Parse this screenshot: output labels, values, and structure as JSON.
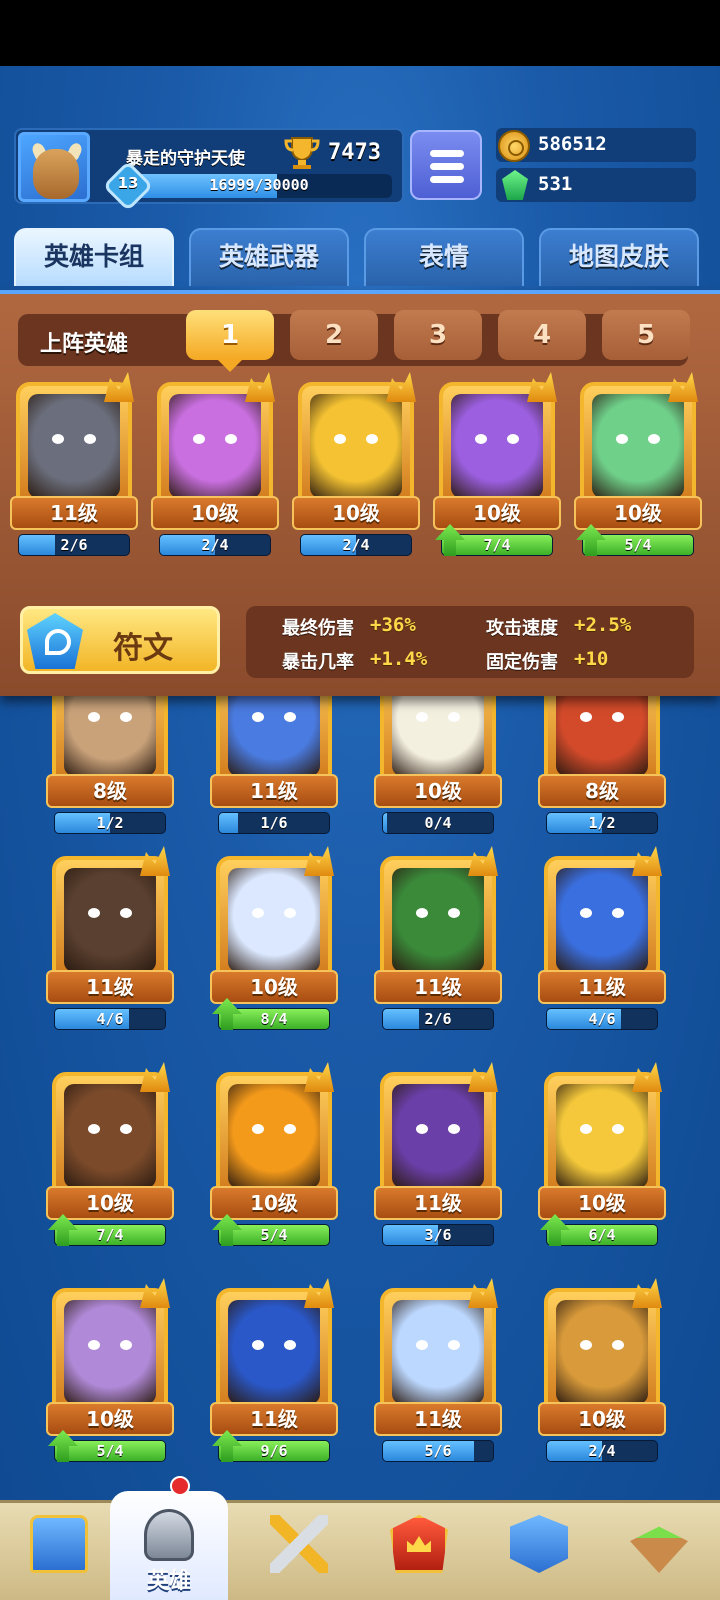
{
  "player": {
    "name": "暴走的守护天使",
    "trophies": "7473",
    "level": "13",
    "xp_text": "16999/30000",
    "xp_fraction": 0.567
  },
  "currency": {
    "coins": "586512",
    "gems": "531"
  },
  "tabs": [
    {
      "label": "英雄卡组",
      "active": true
    },
    {
      "label": "英雄武器",
      "active": false
    },
    {
      "label": "表情",
      "active": false
    },
    {
      "label": "地图皮肤",
      "active": false
    }
  ],
  "team": {
    "label": "上阵英雄",
    "decks": [
      "1",
      "2",
      "3",
      "4",
      "5"
    ],
    "active_deck": "1"
  },
  "selected_heroes": [
    {
      "level": "11级",
      "progress": "2/6",
      "fraction": 0.33,
      "upgrade": false,
      "color": "#6b6f7d"
    },
    {
      "level": "10级",
      "progress": "2/4",
      "fraction": 0.5,
      "upgrade": false,
      "color": "#c96fe0"
    },
    {
      "level": "10级",
      "progress": "2/4",
      "fraction": 0.5,
      "upgrade": false,
      "color": "#f4c232"
    },
    {
      "level": "10级",
      "progress": "7/4",
      "fraction": 1,
      "upgrade": true,
      "color": "#9b5fe0"
    },
    {
      "level": "10级",
      "progress": "5/4",
      "fraction": 1,
      "upgrade": true,
      "color": "#6fd08a"
    }
  ],
  "rune": {
    "label": "符文"
  },
  "stats": [
    {
      "label": "最终伤害",
      "value": "+36%"
    },
    {
      "label": "攻击速度",
      "value": "+2.5%"
    },
    {
      "label": "暴击几率",
      "value": "+1.4%"
    },
    {
      "label": "固定伤害",
      "value": "+10"
    }
  ],
  "heroes": [
    {
      "level": "8级",
      "progress": "1/2",
      "fraction": 0.5,
      "upgrade": false,
      "color": "#c9a27a"
    },
    {
      "level": "11级",
      "progress": "1/6",
      "fraction": 0.17,
      "upgrade": false,
      "color": "#4a7be0"
    },
    {
      "level": "10级",
      "progress": "0/4",
      "fraction": 0,
      "upgrade": false,
      "color": "#f4f0e0"
    },
    {
      "level": "8级",
      "progress": "1/2",
      "fraction": 0.5,
      "upgrade": false,
      "color": "#d24a2a"
    },
    {
      "level": "11级",
      "progress": "4/6",
      "fraction": 0.67,
      "upgrade": false,
      "color": "#5a4030"
    },
    {
      "level": "10级",
      "progress": "8/4",
      "fraction": 1,
      "upgrade": true,
      "color": "#dbe8ff"
    },
    {
      "level": "11级",
      "progress": "2/6",
      "fraction": 0.33,
      "upgrade": false,
      "color": "#3a8a3a"
    },
    {
      "level": "11级",
      "progress": "4/6",
      "fraction": 0.67,
      "upgrade": false,
      "color": "#3a6fe0"
    },
    {
      "level": "10级",
      "progress": "7/4",
      "fraction": 1,
      "upgrade": true,
      "color": "#7a4a2a"
    },
    {
      "level": "10级",
      "progress": "5/4",
      "fraction": 1,
      "upgrade": true,
      "color": "#f49a1a"
    },
    {
      "level": "11级",
      "progress": "3/6",
      "fraction": 0.5,
      "upgrade": false,
      "color": "#6a3fa8"
    },
    {
      "level": "10级",
      "progress": "6/4",
      "fraction": 1,
      "upgrade": true,
      "color": "#f4c83a"
    },
    {
      "level": "10级",
      "progress": "5/4",
      "fraction": 1,
      "upgrade": true,
      "color": "#b08ad8"
    },
    {
      "level": "11级",
      "progress": "9/6",
      "fraction": 1,
      "upgrade": true,
      "color": "#2a58c8"
    },
    {
      "level": "11级",
      "progress": "5/6",
      "fraction": 0.83,
      "upgrade": false,
      "color": "#bcd8ff"
    },
    {
      "level": "10级",
      "progress": "2/4",
      "fraction": 0.5,
      "upgrade": false,
      "color": "#d89a3a"
    }
  ],
  "nav": [
    {
      "label": "",
      "icon": "chest-icon"
    },
    {
      "label": "英雄",
      "icon": "helmet-icon",
      "active": true
    },
    {
      "label": "",
      "icon": "swords-icon"
    },
    {
      "label": "",
      "icon": "crown-icon"
    },
    {
      "label": "",
      "icon": "social-icon"
    },
    {
      "label": "",
      "icon": "island-icon"
    }
  ]
}
